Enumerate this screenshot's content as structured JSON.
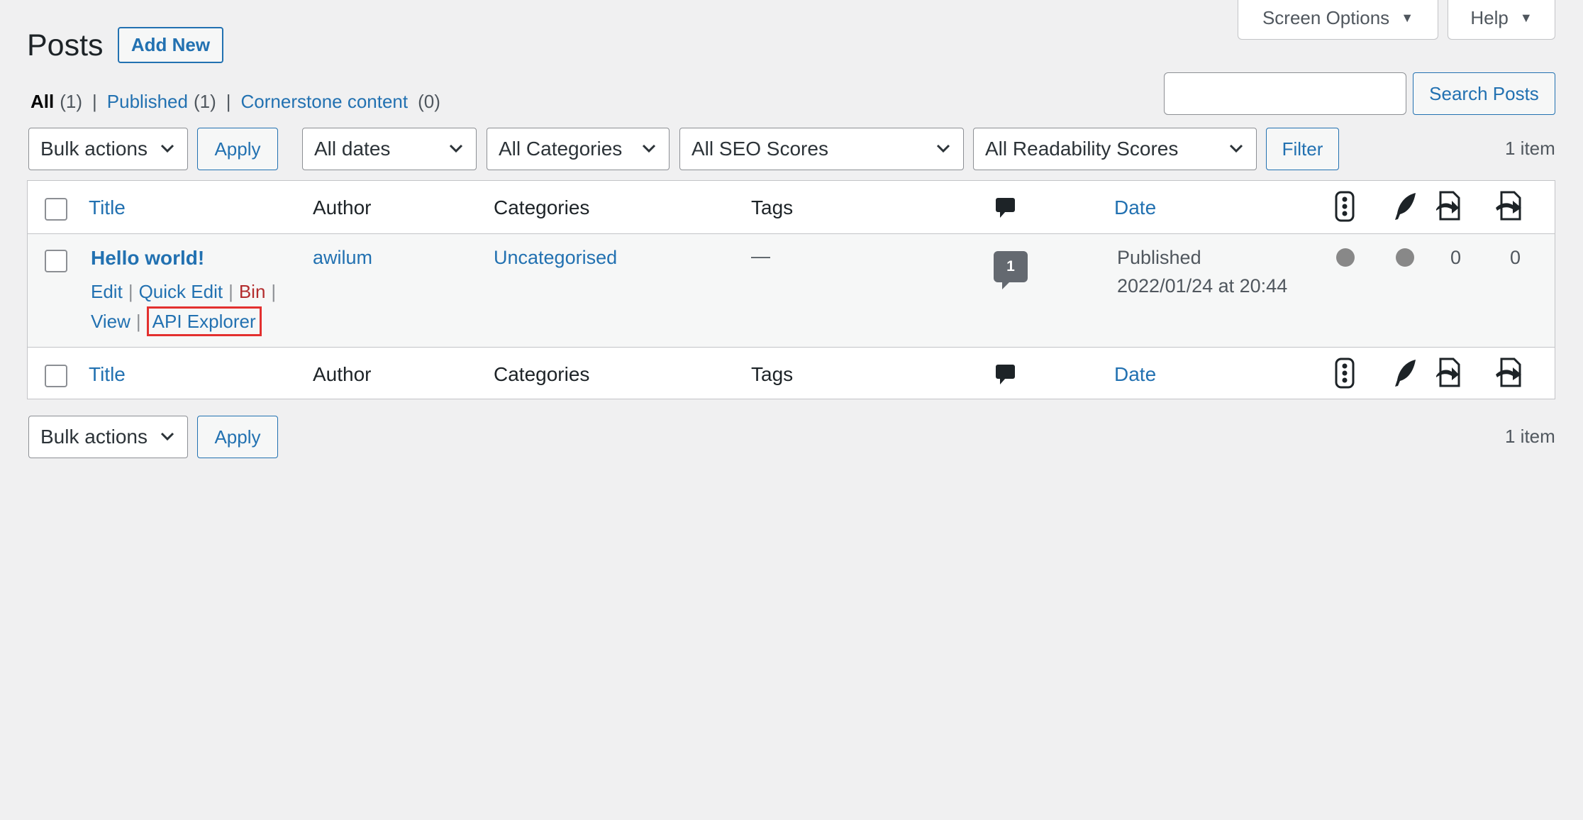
{
  "screen_meta": {
    "screen_options_label": "Screen Options",
    "help_label": "Help",
    "caret": "▼"
  },
  "page": {
    "title": "Posts",
    "add_new_label": "Add New"
  },
  "views": [
    {
      "label": "All",
      "count": "(1)",
      "current": true
    },
    {
      "label": "Published",
      "count": "(1)"
    },
    {
      "label": "Cornerstone content",
      "count": "(0)"
    }
  ],
  "views_separator": "|",
  "search": {
    "value": "",
    "button_label": "Search Posts"
  },
  "filters": {
    "bulk_actions": "Bulk actions",
    "apply_label": "Apply",
    "dates": "All dates",
    "categories": "All Categories",
    "seo_scores": "All SEO Scores",
    "readability_scores": "All Readability Scores",
    "filter_label": "Filter",
    "items_count": "1 item"
  },
  "columns": {
    "title": "Title",
    "author": "Author",
    "categories": "Categories",
    "tags": "Tags",
    "comments_icon": "comment-icon",
    "date": "Date",
    "seo_icon": "traffic-light-icon",
    "readability_icon": "feather-icon",
    "outgoing_links_icon": "outgoing-links-icon",
    "incoming_links_icon": "incoming-links-icon"
  },
  "rows": [
    {
      "title": "Hello world!",
      "author": "awilum",
      "categories": "Uncategorised",
      "tags": "—",
      "comments": "1",
      "date_status": "Published",
      "date_value": "2022/01/24 at 20:44",
      "outgoing_links": "0",
      "incoming_links": "0",
      "actions": {
        "edit": "Edit",
        "quick_edit": "Quick Edit",
        "bin": "Bin",
        "view": "View",
        "api_explorer": "API Explorer",
        "sep": "|"
      }
    }
  ],
  "colors": {
    "link": "#2271b1",
    "bin": "#b32d2e",
    "highlight": "#e3302f",
    "background": "#f0f0f1"
  }
}
